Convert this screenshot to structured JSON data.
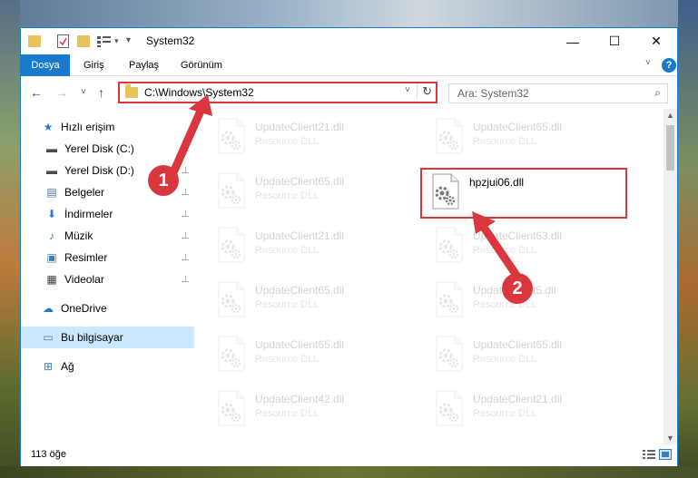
{
  "window": {
    "title": "System32",
    "controls": {
      "minimize": "—",
      "maximize": "☐",
      "close": "✕"
    }
  },
  "ribbon": {
    "tabs": [
      {
        "label": "Dosya",
        "active": true
      },
      {
        "label": "Giriş"
      },
      {
        "label": "Paylaş"
      },
      {
        "label": "Görünüm"
      }
    ],
    "help": "?",
    "collapse_chevron": "˅"
  },
  "navigation": {
    "back": "←",
    "forward": "→",
    "recent": "˅",
    "up": "↑",
    "address": "C:\\Windows\\System32",
    "address_dropdown": "˅",
    "refresh": "↻",
    "search_placeholder": "Ara: System32",
    "search_icon": "⌕"
  },
  "sidebar": {
    "items": [
      {
        "label": "Hızlı erişim",
        "icon": "star-icon",
        "glyph": "★",
        "indent": 0,
        "pinned": false
      },
      {
        "label": "Yerel Disk (C:)",
        "icon": "drive-icon",
        "glyph": "▬",
        "indent": 1,
        "pinned": true
      },
      {
        "label": "Yerel Disk (D:)",
        "icon": "drive-icon",
        "glyph": "▬",
        "indent": 1,
        "pinned": true
      },
      {
        "label": "Belgeler",
        "icon": "documents-icon",
        "glyph": "▤",
        "indent": 1,
        "pinned": true
      },
      {
        "label": "İndirmeler",
        "icon": "download-icon",
        "glyph": "⬇",
        "indent": 1,
        "pinned": true
      },
      {
        "label": "Müzik",
        "icon": "music-icon",
        "glyph": "♪",
        "indent": 1,
        "pinned": true
      },
      {
        "label": "Resimler",
        "icon": "pictures-icon",
        "glyph": "▣",
        "indent": 1,
        "pinned": true
      },
      {
        "label": "Videolar",
        "icon": "video-icon",
        "glyph": "▦",
        "indent": 1,
        "pinned": true
      },
      {
        "label": "OneDrive",
        "icon": "cloud-icon",
        "glyph": "☁",
        "indent": 0,
        "pinned": false
      },
      {
        "label": "Bu bilgisayar",
        "icon": "computer-icon",
        "glyph": "▭",
        "indent": 0,
        "pinned": false,
        "selected": true
      },
      {
        "label": "Ağ",
        "icon": "network-icon",
        "glyph": "⊞",
        "indent": 0,
        "pinned": false
      }
    ],
    "pin_glyph": "📌"
  },
  "files": {
    "left_column": [
      {
        "name": "UpdateClient21.dll",
        "type": "Resource DLL"
      },
      {
        "name": "UpdateClient65.dll",
        "type": "Resource DLL"
      },
      {
        "name": "UpdateClient21.dll",
        "type": "Resource DLL"
      },
      {
        "name": "UpdateClient65.dll",
        "type": "Resource DLL"
      },
      {
        "name": "UpdateClient65.dll",
        "type": "Resource DLL"
      },
      {
        "name": "UpdateClient42.dll",
        "type": "Resource DLL"
      }
    ],
    "right_column": [
      {
        "name": "UpdateClient65.dll",
        "type": "Resource DLL"
      },
      {
        "name": "hpzjui06.dll",
        "type": "",
        "highlight": true
      },
      {
        "name": "UpdateClient63.dll",
        "type": "Resource DLL"
      },
      {
        "name": "UpdateClient5.dll",
        "type": "Resource DLL"
      },
      {
        "name": "UpdateClient65.dll",
        "type": "Resource DLL"
      },
      {
        "name": "UpdateClient21.dll",
        "type": "Resource DLL"
      }
    ]
  },
  "status": {
    "count": "113 öğe"
  },
  "annotations": {
    "marker1": "1",
    "marker2": "2",
    "color": "#d9363e"
  }
}
